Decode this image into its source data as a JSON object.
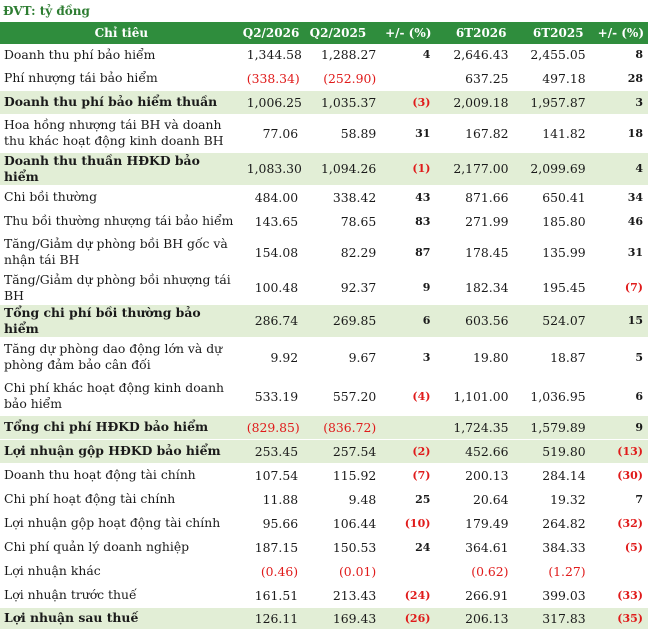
{
  "unit_label": "ĐVT: tỷ đồng",
  "columns": [
    "Chỉ tiêu",
    "Q2/2026",
    "Q2/2025",
    "+/- (%)",
    "6T2026",
    "6T2025",
    "+/- (%)"
  ],
  "rows": [
    {
      "label": "Doanh thu phí bảo hiểm",
      "q26": "1,344.58",
      "q25": "1,288.27",
      "chg1": "4",
      "t26": "2,646.43",
      "t25": "2,455.05",
      "chg2": "8",
      "hl": false,
      "h": 22,
      "neg": []
    },
    {
      "label": "Phí nhượng tái bảo hiểm",
      "q26": "(338.34)",
      "q25": "(252.90)",
      "chg1": "",
      "t26": "637.25",
      "t25": "497.18",
      "chg2": "28",
      "hl": false,
      "h": 24,
      "neg": [
        "q26",
        "q25"
      ]
    },
    {
      "label": "Doanh thu phí bảo hiểm thuần",
      "q26": "1,006.25",
      "q25": "1,035.37",
      "chg1": "(3)",
      "t26": "2,009.18",
      "t25": "1,957.87",
      "chg2": "3",
      "hl": true,
      "h": 24,
      "neg": [
        "chg1"
      ]
    },
    {
      "label": "Hoa hồng nhượng tái BH và doanh thu khác hoạt động kinh doanh BH",
      "q26": "77.06",
      "q25": "58.89",
      "chg1": "31",
      "t26": "167.82",
      "t25": "141.82",
      "chg2": "18",
      "hl": false,
      "h": 38,
      "neg": []
    },
    {
      "label": "Doanh thu thuần HĐKD bảo hiểm",
      "q26": "1,083.30",
      "q25": "1,094.26",
      "chg1": "(1)",
      "t26": "2,177.00",
      "t25": "2,099.69",
      "chg2": "4",
      "hl": true,
      "h": 24,
      "neg": [
        "chg1"
      ]
    },
    {
      "label": "Chi bồi thường",
      "q26": "484.00",
      "q25": "338.42",
      "chg1": "43",
      "t26": "871.66",
      "t25": "650.41",
      "chg2": "34",
      "hl": false,
      "h": 24,
      "neg": []
    },
    {
      "label": "Thu bồi thường nhượng tái bảo hiểm",
      "q26": "143.65",
      "q25": "78.65",
      "chg1": "83",
      "t26": "271.99",
      "t25": "185.80",
      "chg2": "46",
      "hl": false,
      "h": 24,
      "neg": []
    },
    {
      "label": "Tăng/Giảm dự phòng bồi BH gốc và nhận tái BH",
      "q26": "154.08",
      "q25": "82.29",
      "chg1": "87",
      "t26": "178.45",
      "t25": "135.99",
      "chg2": "31",
      "hl": false,
      "h": 38,
      "neg": []
    },
    {
      "label": "Tăng/Giảm dự phòng bồi nhượng tái BH",
      "q26": "100.48",
      "q25": "92.37",
      "chg1": "9",
      "t26": "182.34",
      "t25": "195.45",
      "chg2": "(7)",
      "hl": false,
      "h": 28,
      "neg": [
        "chg2"
      ]
    },
    {
      "label": "Tổng chi phí bồi thường bảo hiểm",
      "q26": "286.74",
      "q25": "269.85",
      "chg1": "6",
      "t26": "603.56",
      "t25": "524.07",
      "chg2": "15",
      "hl": true,
      "h": 24,
      "neg": []
    },
    {
      "label": "Tăng dự phòng dao động lớn và dự phòng đảm bảo cân đối",
      "q26": "9.92",
      "q25": "9.67",
      "chg1": "3",
      "t26": "19.80",
      "t25": "18.87",
      "chg2": "5",
      "hl": false,
      "h": 40,
      "neg": []
    },
    {
      "label": "Chi phí khác hoạt động kinh doanh bảo hiểm",
      "q26": "533.19",
      "q25": "557.20",
      "chg1": "(4)",
      "t26": "1,101.00",
      "t25": "1,036.95",
      "chg2": "6",
      "hl": false,
      "h": 38,
      "neg": [
        "chg1"
      ]
    },
    {
      "label": "Tổng chi phí HĐKD bảo hiểm",
      "q26": "(829.85)",
      "q25": "(836.72)",
      "chg1": "",
      "t26": "1,724.35",
      "t25": "1,579.89",
      "chg2": "9",
      "hl": true,
      "h": 24,
      "neg": [
        "q26",
        "q25"
      ]
    },
    {
      "label": "Lợi nhuận gộp HĐKD bảo hiểm",
      "q26": "253.45",
      "q25": "257.54",
      "chg1": "(2)",
      "t26": "452.66",
      "t25": "519.80",
      "chg2": "(13)",
      "hl": true,
      "h": 24,
      "neg": [
        "chg1",
        "chg2"
      ]
    },
    {
      "label": "Doanh thu hoạt động tài chính",
      "q26": "107.54",
      "q25": "115.92",
      "chg1": "(7)",
      "t26": "200.13",
      "t25": "284.14",
      "chg2": "(30)",
      "hl": false,
      "h": 24,
      "neg": [
        "chg1",
        "chg2"
      ]
    },
    {
      "label": "Chi phí hoạt động tài chính",
      "q26": "11.88",
      "q25": "9.48",
      "chg1": "25",
      "t26": "20.64",
      "t25": "19.32",
      "chg2": "7",
      "hl": false,
      "h": 24,
      "neg": []
    },
    {
      "label": "Lợi nhuận gộp hoạt động tài chính",
      "q26": "95.66",
      "q25": "106.44",
      "chg1": "(10)",
      "t26": "179.49",
      "t25": "264.82",
      "chg2": "(32)",
      "hl": false,
      "h": 24,
      "neg": [
        "chg1",
        "chg2"
      ]
    },
    {
      "label": "Chi phí quản lý doanh nghiệp",
      "q26": "187.15",
      "q25": "150.53",
      "chg1": "24",
      "t26": "364.61",
      "t25": "384.33",
      "chg2": "(5)",
      "hl": false,
      "h": 24,
      "neg": [
        "chg2"
      ]
    },
    {
      "label": "Lợi nhuận khác",
      "q26": "(0.46)",
      "q25": "(0.01)",
      "chg1": "",
      "t26": "(0.62)",
      "t25": "(1.27)",
      "chg2": "",
      "hl": false,
      "h": 24,
      "neg": [
        "q26",
        "q25",
        "t26",
        "t25"
      ]
    },
    {
      "label": "Lợi nhuận trước thuế",
      "q26": "161.51",
      "q25": "213.43",
      "chg1": "(24)",
      "t26": "266.91",
      "t25": "399.03",
      "chg2": "(33)",
      "hl": false,
      "h": 24,
      "neg": [
        "chg1",
        "chg2"
      ]
    },
    {
      "label": "Lợi nhuận sau thuế",
      "q26": "126.11",
      "q25": "169.43",
      "chg1": "(26)",
      "t26": "206.13",
      "t25": "317.83",
      "chg2": "(35)",
      "hl": true,
      "h": 22,
      "neg": [
        "chg1",
        "chg2"
      ]
    }
  ]
}
